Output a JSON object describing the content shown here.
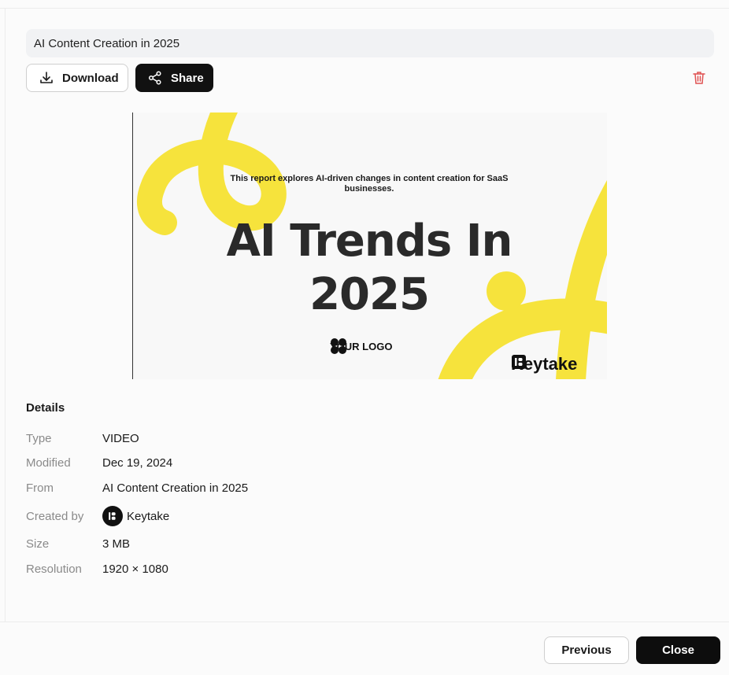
{
  "asset": {
    "title": "AI Content Creation in 2025"
  },
  "toolbar": {
    "download_label": "Download",
    "share_label": "Share",
    "icons": [
      "download-icon",
      "share-icon",
      "trash-icon"
    ],
    "delete_color": "#e05252"
  },
  "preview": {
    "subtitle": "This report explores AI-driven changes in content creation for SaaS businesses.",
    "headline": "AI Trends In 2025",
    "logo_text": "YOUR LOGO",
    "brand": "Keytake",
    "accent_color": "#f6e33c"
  },
  "details": {
    "heading": "Details",
    "rows": [
      {
        "label": "Type",
        "value": "VIDEO"
      },
      {
        "label": "Modified",
        "value": "Dec 19, 2024"
      },
      {
        "label": "From",
        "value": "AI Content Creation in 2025"
      },
      {
        "label": "Created by",
        "value": "Keytake"
      },
      {
        "label": "Size",
        "value": "3 MB"
      },
      {
        "label": "Resolution",
        "value": "1920 × 1080"
      }
    ]
  },
  "footer": {
    "previous_label": "Previous",
    "close_label": "Close"
  }
}
